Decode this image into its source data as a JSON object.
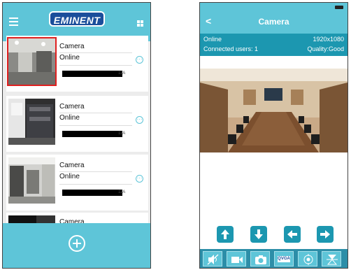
{
  "left": {
    "logo": "EMINENT",
    "cameras": [
      {
        "name": "Camera",
        "status": "Online",
        "id_suffix": "11A"
      },
      {
        "name": "Camera",
        "status": "Online",
        "id_suffix": "11A"
      },
      {
        "name": "Camera",
        "status": "Online",
        "id_suffix": "11A"
      },
      {
        "name": "Camera"
      }
    ],
    "more_glyph": "···"
  },
  "right": {
    "title": "Camera",
    "back_glyph": "<",
    "status": "Online",
    "resolution": "1920x1080",
    "connected_users": "Connected users: 1",
    "quality": "Quality:Good",
    "toolbar": {
      "qvga_label": "QVGA"
    }
  },
  "colors": {
    "accent": "#5ec5d8",
    "dark_accent": "#1c97b0",
    "brand": "#1b4e9b",
    "selection": "#e02020"
  }
}
